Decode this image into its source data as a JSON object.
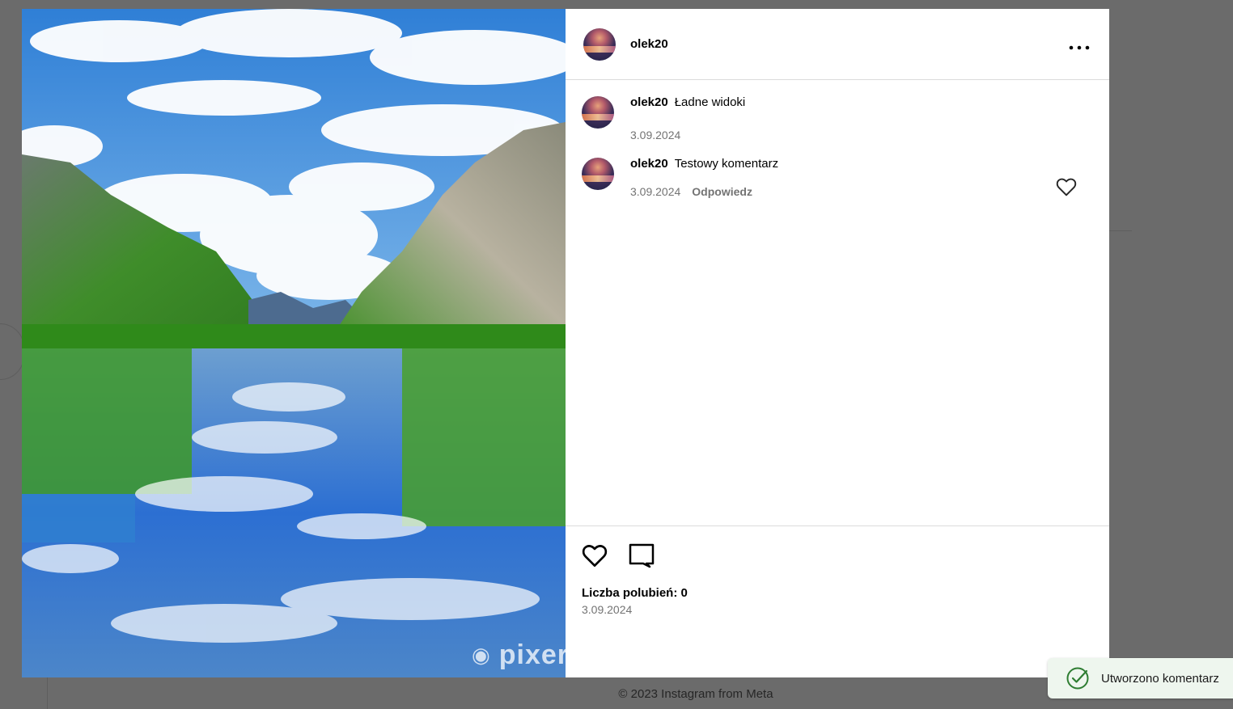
{
  "post": {
    "username": "olek20",
    "photo_watermark": "pixer",
    "like_count_label": "Liczba polubień: 0",
    "date": "3.09.2024"
  },
  "comments": [
    {
      "username": "olek20",
      "text": "Ładne widoki",
      "date": "3.09.2024"
    },
    {
      "username": "olek20",
      "text": "Testowy komentarz",
      "date": "3.09.2024",
      "reply_label": "Odpowiedz"
    }
  ],
  "footer": {
    "copyright": "© 2023 Instagram from Meta"
  },
  "toast": {
    "message": "Utworzono komentarz",
    "color": "#2e7d32"
  },
  "icons": {
    "more": "more-horizontal-icon",
    "like": "heart-icon",
    "comment": "comment-icon",
    "success": "check-circle-icon"
  }
}
